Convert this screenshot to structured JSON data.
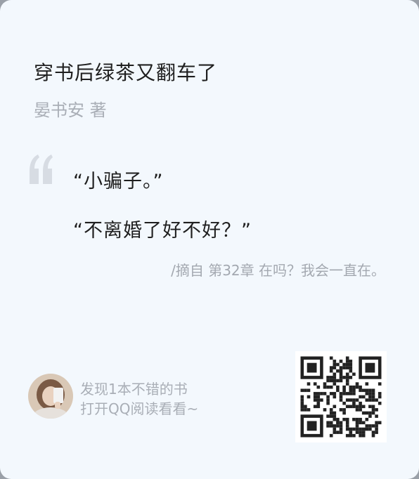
{
  "book": {
    "title": "穿书后绿茶又翻车了",
    "author": "晏书安 著"
  },
  "quote": {
    "icon": "quote-mark-icon",
    "lines": [
      "“小骗子。”",
      "“不离婚了好不好？”"
    ],
    "source": "/摘自 第32章 在吗？我会一直在。"
  },
  "footer": {
    "promo_line1": "发现1本不错的书",
    "promo_line2": "打开QQ阅读看看~",
    "avatar": "user-avatar",
    "qr": "qr-code"
  },
  "colors": {
    "card_bg": "#f3f8fd",
    "title": "#1f1f1f",
    "muted": "#a9aeb6",
    "quote_mark": "#d7dce3"
  }
}
